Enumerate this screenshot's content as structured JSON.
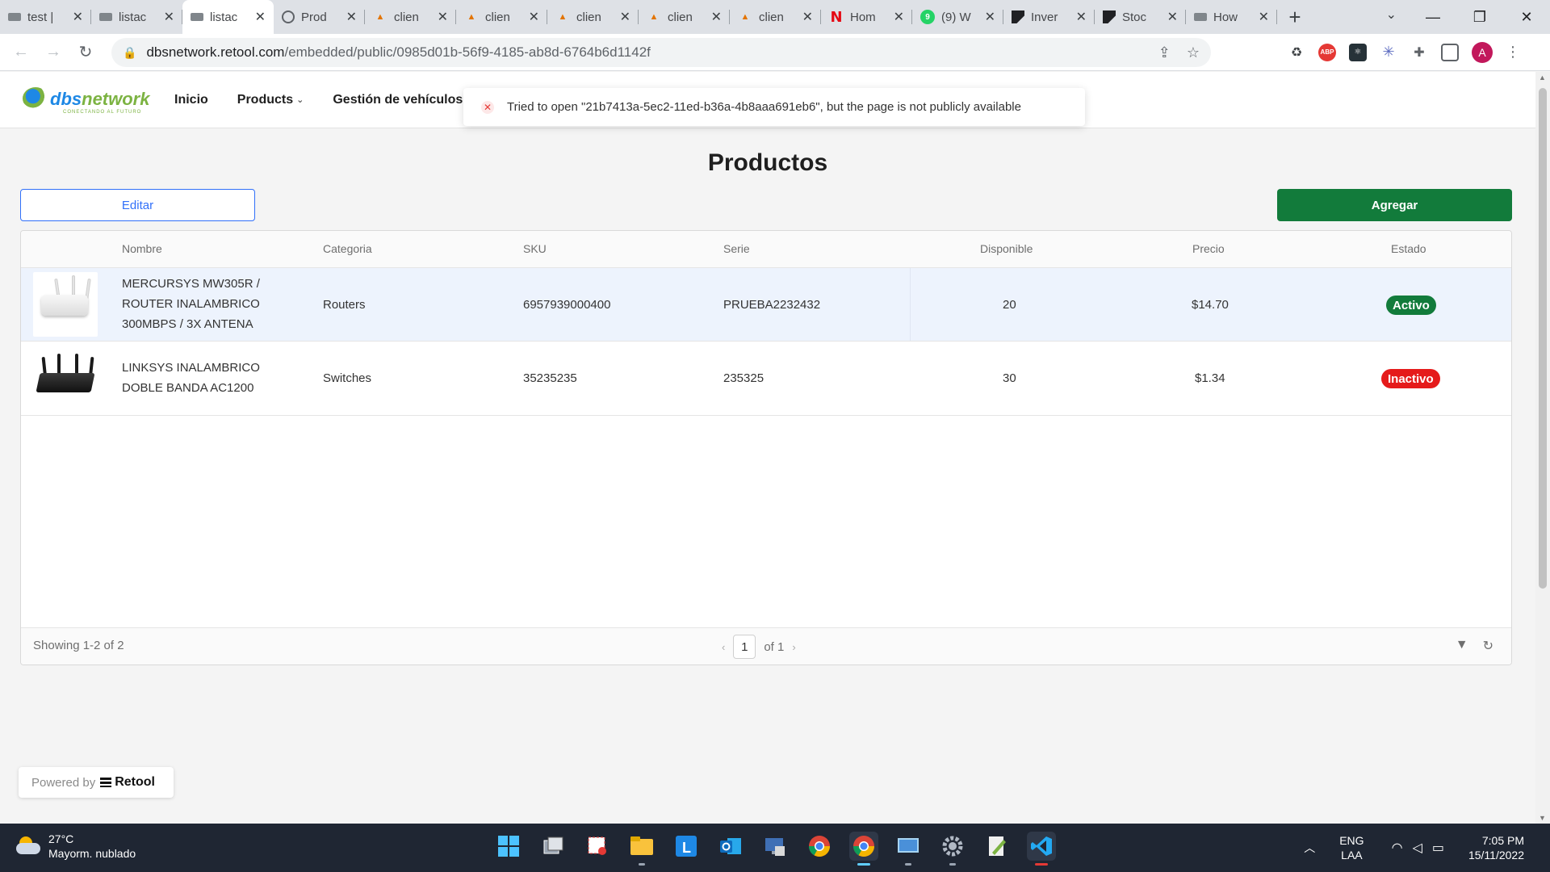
{
  "browser": {
    "tabs": [
      {
        "title": "test |",
        "icon": "doc-icon",
        "active": false
      },
      {
        "title": "listac",
        "icon": "doc-icon",
        "active": false
      },
      {
        "title": "listac",
        "icon": "doc-icon",
        "active": true
      },
      {
        "title": "Prod",
        "icon": "globe-icon",
        "active": false
      },
      {
        "title": "clien",
        "icon": "pma-icon",
        "active": false
      },
      {
        "title": "clien",
        "icon": "pma-icon",
        "active": false
      },
      {
        "title": "clien",
        "icon": "pma-icon",
        "active": false
      },
      {
        "title": "clien",
        "icon": "pma-icon",
        "active": false
      },
      {
        "title": "clien",
        "icon": "pma-icon",
        "active": false
      },
      {
        "title": "Hom",
        "icon": "netflix-icon",
        "active": false
      },
      {
        "title": "(9) W",
        "icon": "whatsapp-icon",
        "active": false
      },
      {
        "title": "Inver",
        "icon": "stock-icon",
        "active": false
      },
      {
        "title": "Stoc",
        "icon": "stock-icon",
        "active": false
      },
      {
        "title": "How",
        "icon": "doc-icon",
        "active": false
      }
    ],
    "new_tab": "+",
    "url_domain": "dbsnetwork.retool.com",
    "url_path": "/embedded/public/0985d01b-56f9-4185-ab8d-6764b6d1142f",
    "profile_initial": "A",
    "ext_abp": "ABP"
  },
  "app": {
    "logo": {
      "part1": "dbs",
      "part2": "network",
      "tagline": "CONECTANDO AL FUTURO"
    },
    "nav": {
      "inicio": "Inicio",
      "products": "Products",
      "vehiculos": "Gestión de vehículos"
    },
    "toast": "Tried to open \"21b7413a-5ec2-11ed-b36a-4b8aaa691eb6\", but the page is not publicly available",
    "page_title": "Productos",
    "edit_label": "Editar",
    "add_label": "Agregar",
    "colors": {
      "accent": "#3170f9",
      "add": "#127b3b",
      "active": "#127b3b",
      "inactive": "#e51b1b"
    }
  },
  "table": {
    "headers": {
      "name": "Nombre",
      "category": "Categoria",
      "sku": "SKU",
      "serie": "Serie",
      "available": "Disponible",
      "price": "Precio",
      "status": "Estado"
    },
    "rows": [
      {
        "name1": "MERCURSYS MW305R /",
        "name2": "ROUTER INALAMBRICO",
        "name3": "300MBPS / 3X ANTENA",
        "category": "Routers",
        "sku": "6957939000400",
        "serie": "PRUEBA2232432",
        "available": "20",
        "price": "$14.70",
        "status": "Activo"
      },
      {
        "name1": "LINKSYS INALAMBRICO",
        "name2": "DOBLE BANDA AC1200",
        "category": "Switches",
        "sku": "35235235",
        "serie": "235325",
        "available": "30",
        "price": "$1.34",
        "status": "Inactivo"
      }
    ],
    "footer": {
      "showing": "Showing 1-2 of 2",
      "page": "1",
      "of": "of 1"
    }
  },
  "powered": {
    "label": "Powered by",
    "brand": "Retool"
  },
  "taskbar": {
    "temp": "27°C",
    "weather": "Mayorm. nublado",
    "lang1": "ENG",
    "lang2": "LAA",
    "time": "7:05 PM",
    "date": "15/11/2022"
  }
}
